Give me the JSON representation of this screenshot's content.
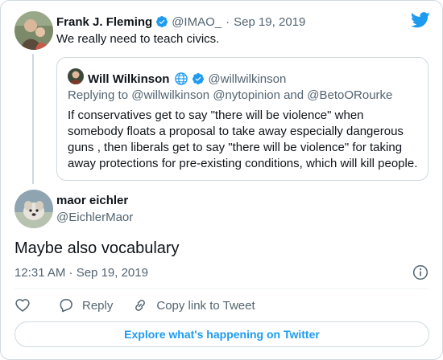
{
  "colors": {
    "accent": "#1d9bf0",
    "text": "#0f1419",
    "muted": "#536471",
    "border": "#cfd9de"
  },
  "parent_tweet": {
    "author_name": "Frank J. Fleming",
    "author_handle": "@IMAO_",
    "separator": "·",
    "date": "Sep 19, 2019",
    "text": "We really need to teach civics.",
    "verified": true
  },
  "quoted_tweet": {
    "author_name": "Will Wilkinson",
    "author_handle": "@willwilkinson",
    "verified": true,
    "replying_to": "Replying to @willwilkinson @nytopinion and @BetoORourke",
    "text": "If conservatives get to say \"there will be violence\" when somebody floats a proposal to take away especially dangerous guns , then liberals get to say \"there will be violence\" for taking away protections for pre-existing conditions, which will kill people."
  },
  "main_tweet": {
    "author_name": "maor eichler",
    "author_handle": "@EichlerMaor",
    "text": "Maybe also vocabulary",
    "timestamp": "12:31 AM · Sep 19, 2019"
  },
  "actions": {
    "reply_label": "Reply",
    "copy_link_label": "Copy link to Tweet"
  },
  "explore_label": "Explore what's happening on Twitter",
  "icons": [
    "twitter-bird-icon",
    "verified-icon",
    "globe-icon",
    "info-icon",
    "heart-icon",
    "reply-icon",
    "link-icon"
  ]
}
